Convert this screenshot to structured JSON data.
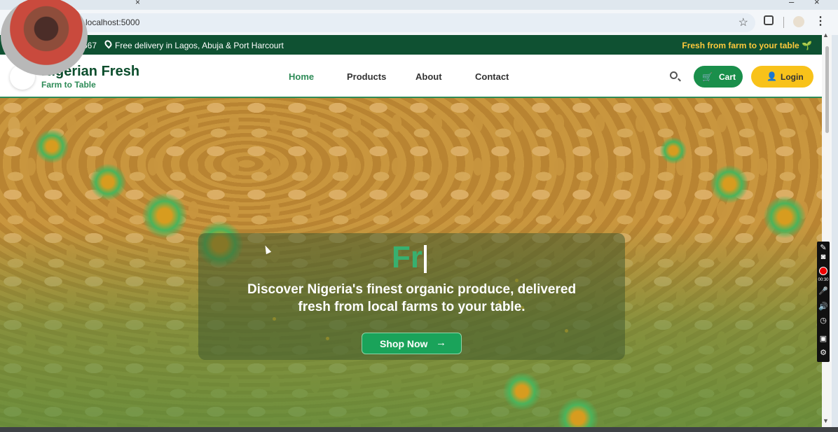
{
  "browser": {
    "url": "localhost:5000",
    "tab_close": "×",
    "window_controls": [
      "–",
      "×"
    ],
    "menu": "⋮",
    "star": "☆"
  },
  "topbar": {
    "phone_partial": "567",
    "delivery": "Free delivery in Lagos, Abuja & Port Harcourt",
    "tagline": "Fresh from farm to your table 🌱"
  },
  "brand": {
    "name": "Nigerian Fresh",
    "subtitle": "Farm to Table"
  },
  "nav": {
    "links": [
      "Home",
      "Products",
      "About",
      "Contact"
    ],
    "cart": "Cart",
    "login": "Login"
  },
  "hero": {
    "typed_title": "Fr",
    "description": "Discover Nigeria's finest organic produce, delivered fresh from local farms to your table.",
    "cta": "Shop Now",
    "cta_arrow": "→"
  },
  "recorder": {
    "time": "00:30"
  },
  "colors": {
    "topbar_green": "#0f5132",
    "accent_green": "#2e8b57",
    "accent_yellow": "#f8c21a"
  }
}
